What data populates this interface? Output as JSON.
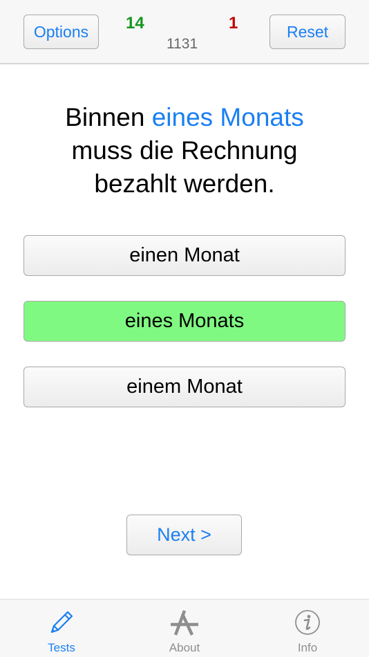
{
  "header": {
    "options_label": "Options",
    "reset_label": "Reset",
    "correct_count": "14",
    "wrong_count": "1",
    "question_id": "1131"
  },
  "question": {
    "prefix": "Binnen ",
    "highlight": "eines Monats",
    "line2": "muss die Rechnung",
    "line3": "bezahlt werden."
  },
  "answers": [
    {
      "label": "einen Monat",
      "state": "default"
    },
    {
      "label": "eines Monats",
      "state": "correct"
    },
    {
      "label": "einem Monat",
      "state": "default"
    }
  ],
  "next_label": "Next >",
  "colors": {
    "accent": "#1a7ff2",
    "correct_green": "#80f982",
    "score_correct": "#14961e",
    "score_wrong": "#c00000",
    "inactive_tab": "#8e8e8e"
  },
  "tabbar": {
    "tabs": [
      {
        "label": "Tests",
        "icon": "pencil-icon",
        "active": true
      },
      {
        "label": "About",
        "icon": "app-store-icon",
        "active": false
      },
      {
        "label": "Info",
        "icon": "info-icon",
        "active": false
      }
    ]
  }
}
